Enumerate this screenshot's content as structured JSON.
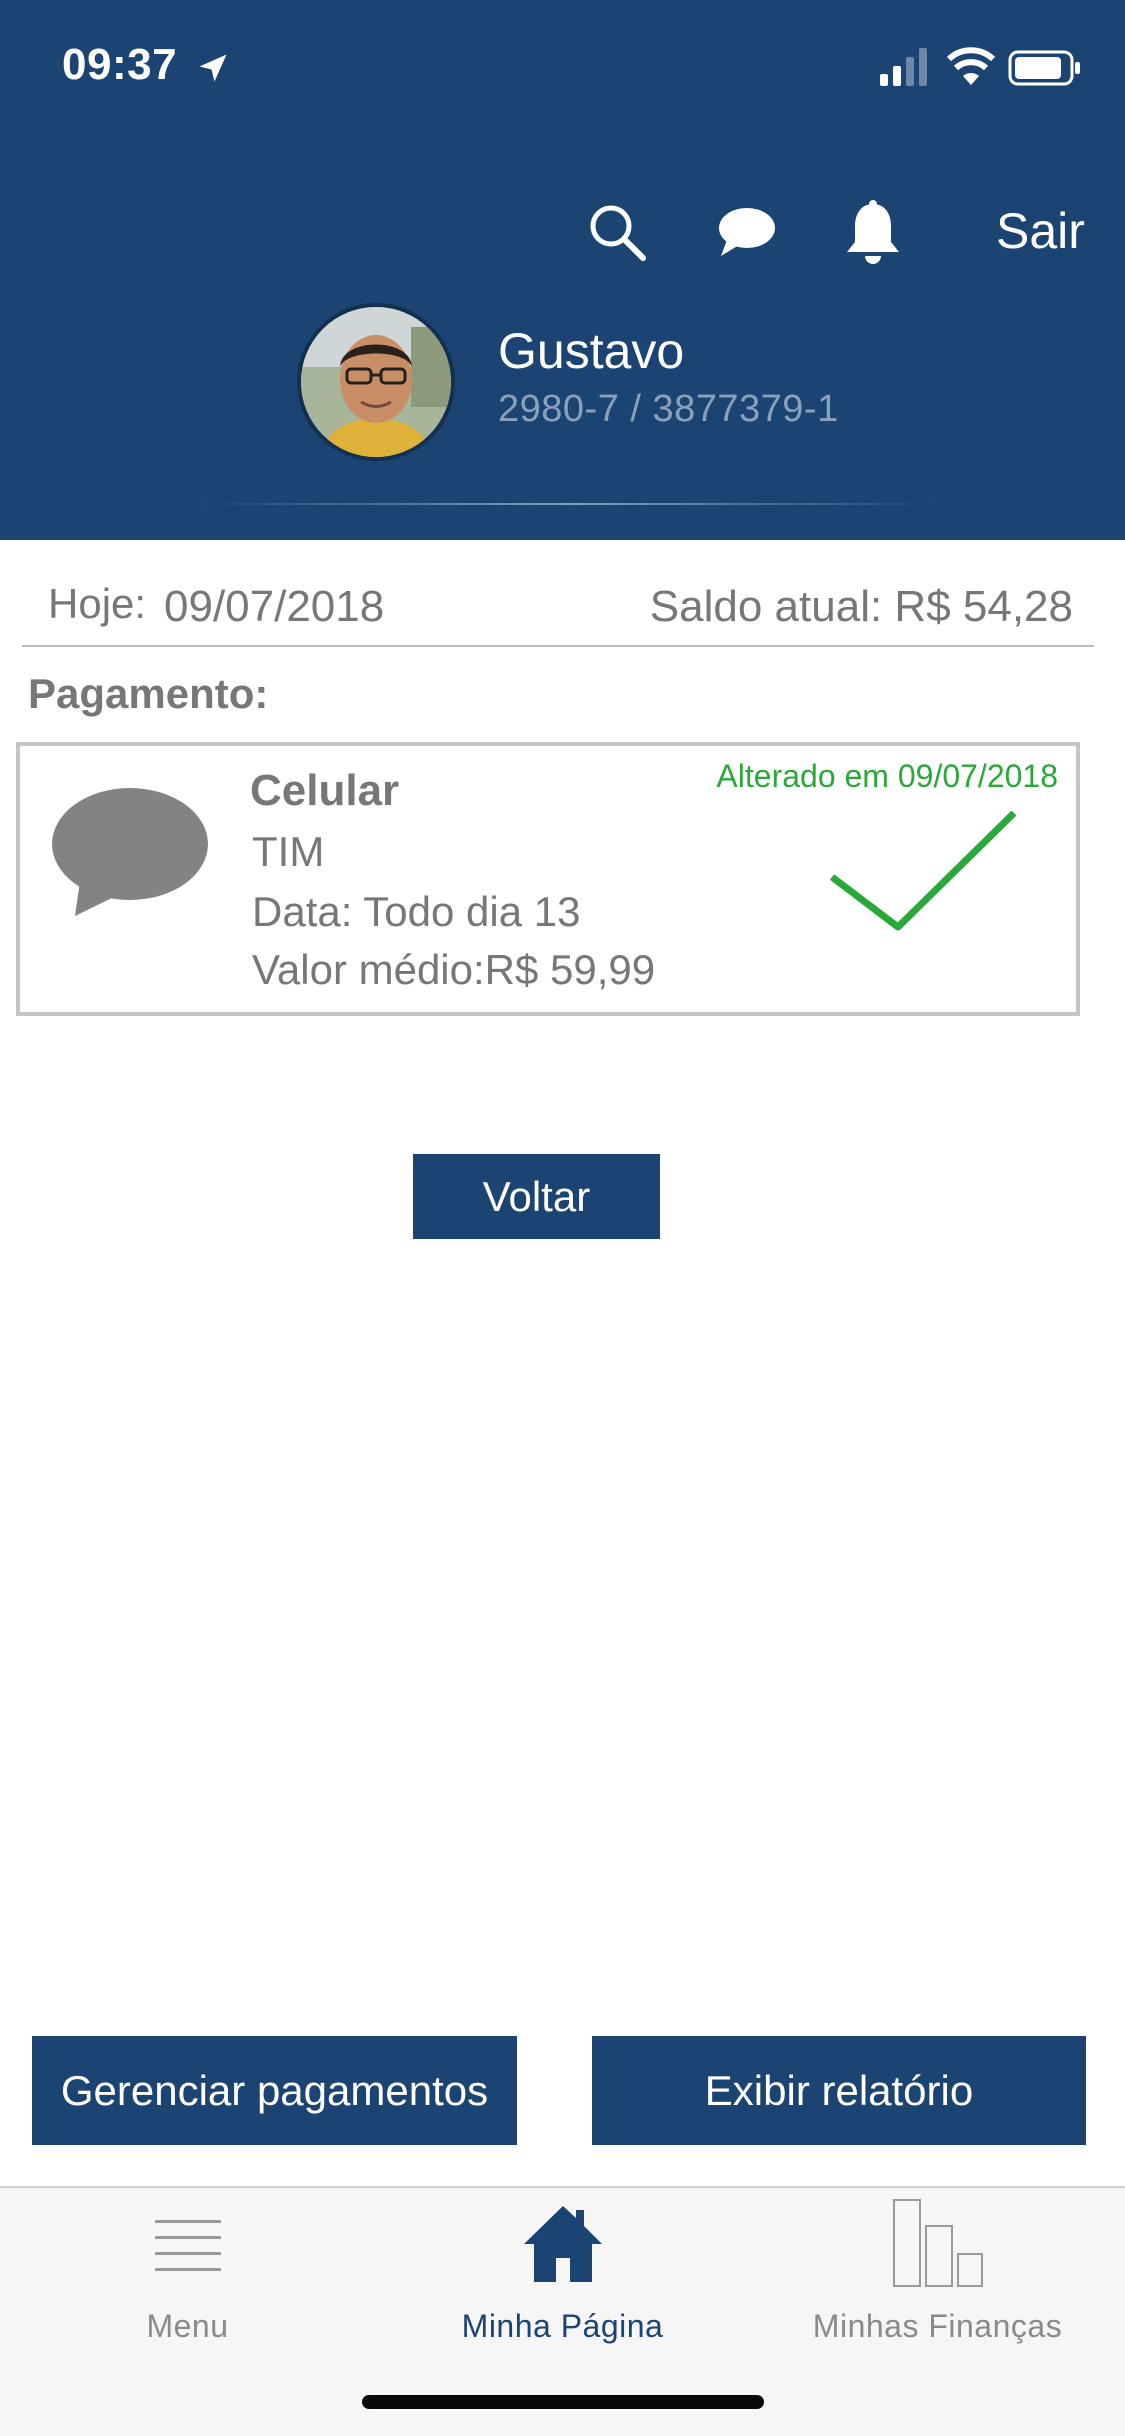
{
  "status_bar": {
    "time": "09:37"
  },
  "header": {
    "logout_label": "Sair",
    "user_name": "Gustavo",
    "account": "2980-7 / 3877379-1",
    "icons": [
      "search-icon",
      "chat-icon",
      "bell-icon"
    ]
  },
  "summary": {
    "today_label": "Hoje:",
    "today_date": "09/07/2018",
    "balance": "Saldo atual: R$ 54,28"
  },
  "section_title": "Pagamento:",
  "payment": {
    "icon": "chat-bubble-icon",
    "title": "Celular",
    "carrier": "TIM",
    "date": "Data: Todo dia 13",
    "average_value": "Valor médio:R$ 59,99",
    "changed": "Alterado em 09/07/2018",
    "status_icon": "checkmark-icon"
  },
  "buttons": {
    "back": "Voltar",
    "manage": "Gerenciar pagamentos",
    "report": "Exibir relatório"
  },
  "tabbar": {
    "tabs": [
      {
        "label": "Menu",
        "icon": "hamburger-icon"
      },
      {
        "label": "Minha Página",
        "icon": "home-icon",
        "active": true
      },
      {
        "label": "Minhas Finanças",
        "icon": "bar-chart-icon"
      }
    ]
  },
  "colors": {
    "primary": "#1c4473",
    "success": "#2aa83a",
    "text_muted": "#777777"
  }
}
